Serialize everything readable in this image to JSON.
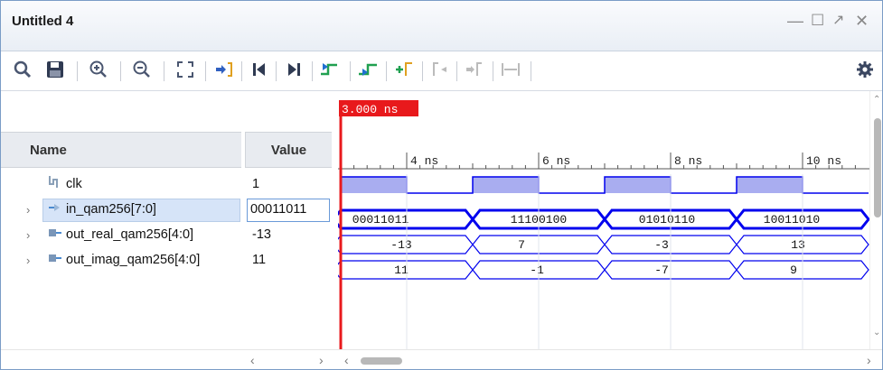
{
  "window": {
    "title": "Untitled 4"
  },
  "toolbar": {
    "items": [
      "search-icon",
      "save-icon",
      "zoom-in-icon",
      "zoom-out-icon",
      "zoom-fit-icon",
      "go-to-cursor-icon",
      "go-to-time-zero-icon",
      "go-to-last-time-icon",
      "previous-transition-icon",
      "next-transition-icon",
      "add-marker-icon",
      "previous-marker-icon",
      "next-marker-icon",
      "swap-cursors-icon",
      "settings-icon"
    ]
  },
  "columns": {
    "name_label": "Name",
    "value_label": "Value"
  },
  "signals": [
    {
      "name": "clk",
      "value": "1",
      "icon": "clock-signal-icon"
    },
    {
      "name": "in_qam256[7:0]",
      "value": "00011011",
      "icon": "input-bus-icon"
    },
    {
      "name": "out_real_qam256[4:0]",
      "value": "-13",
      "icon": "output-bus-icon"
    },
    {
      "name": "out_imag_qam256[4:0]",
      "value": "11",
      "icon": "output-bus-icon"
    }
  ],
  "cursor": {
    "label": "3.000 ns",
    "time": 3.0
  },
  "timescale": {
    "ticks": [
      "4 ns",
      "6 ns",
      "8 ns",
      "10 ns"
    ],
    "start_ns": 0,
    "end_ns": 10.5
  },
  "waves": {
    "in_qam256": [
      "00011011",
      "11100100",
      "01010110",
      "10011010"
    ],
    "out_real": [
      "-13",
      "7",
      "-3",
      "13"
    ],
    "out_imag": [
      "11",
      "-1",
      "-7",
      "9"
    ]
  },
  "colors": {
    "cursor": "#e8191c",
    "wave": "#0000ee",
    "clock_fill": "#a9adf0",
    "accent": "#0000cc",
    "selected_row": "#d6e4f8"
  }
}
